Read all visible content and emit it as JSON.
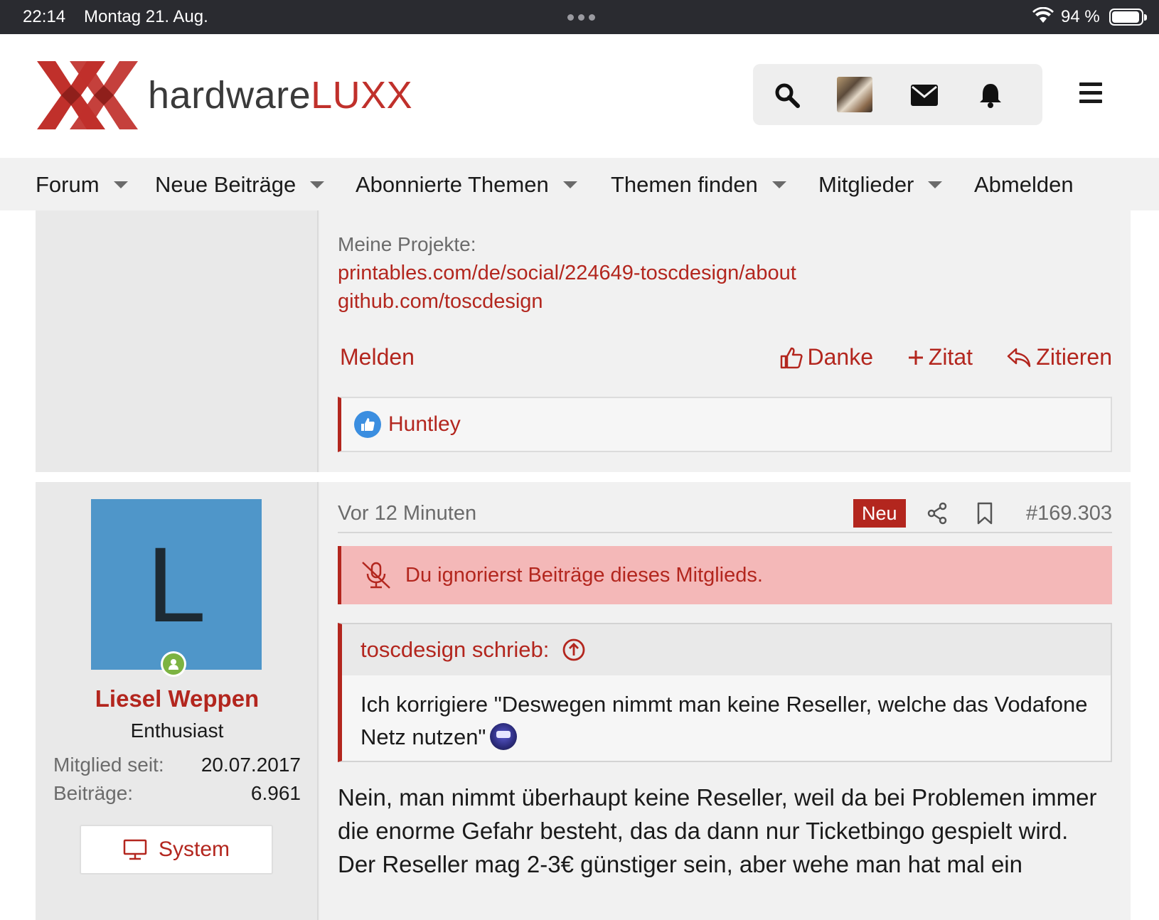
{
  "status_bar": {
    "time": "22:14",
    "date": "Montag 21. Aug.",
    "battery_pct": "94 %",
    "battery_level": 0.94
  },
  "header": {
    "brand_prefix": "hardware",
    "brand_suffix": "LUXX"
  },
  "nav": {
    "items": [
      {
        "label": "Forum",
        "dropdown": true
      },
      {
        "label": "Neue Beiträge",
        "dropdown": true
      },
      {
        "label": "Abonnierte Themen",
        "dropdown": true
      },
      {
        "label": "Themen finden",
        "dropdown": true
      },
      {
        "label": "Mitglieder",
        "dropdown": true
      },
      {
        "label": "Abmelden",
        "dropdown": false
      }
    ]
  },
  "post1": {
    "signature_label": "Meine Projekte:",
    "signature_links": [
      "printables.com/de/social/224649-toscdesign/about",
      "github.com/toscdesign"
    ],
    "report_label": "Melden",
    "like_label": "Danke",
    "multiquote_label": "Zitat",
    "reply_label": "Zitieren",
    "reaction_users": "Huntley"
  },
  "post2": {
    "avatar_letter": "L",
    "username": "Liesel Weppen",
    "user_title": "Enthusiast",
    "stats": [
      {
        "label": "Mitglied seit:",
        "value": "20.07.2017"
      },
      {
        "label": "Beiträge:",
        "value": "6.961"
      }
    ],
    "system_button": "System",
    "time": "Vor 12 Minuten",
    "badge": "Neu",
    "post_number": "#169.303",
    "ignore_notice": "Du ignorierst Beiträge dieses Mitglieds.",
    "quote_author": "toscdesign schrieb:",
    "quote_text": "Ich korrigiere \"Deswegen nimmt man keine Reseller, welche das Vodafone Netz nutzen\"",
    "body_lines": [
      "Nein, man nimmt überhaupt keine Reseller, weil da bei Problemen immer die enorme Gefahr besteht, das da dann nur Ticketbingo gespielt wird.",
      "Der Reseller mag 2-3€ günstiger sein, aber wehe man hat mal ein"
    ]
  },
  "colors": {
    "accent": "#b3261e",
    "avatar_bg": "#4f96c9",
    "ignore_bg": "#f4b8b8",
    "online": "#7cb342"
  }
}
